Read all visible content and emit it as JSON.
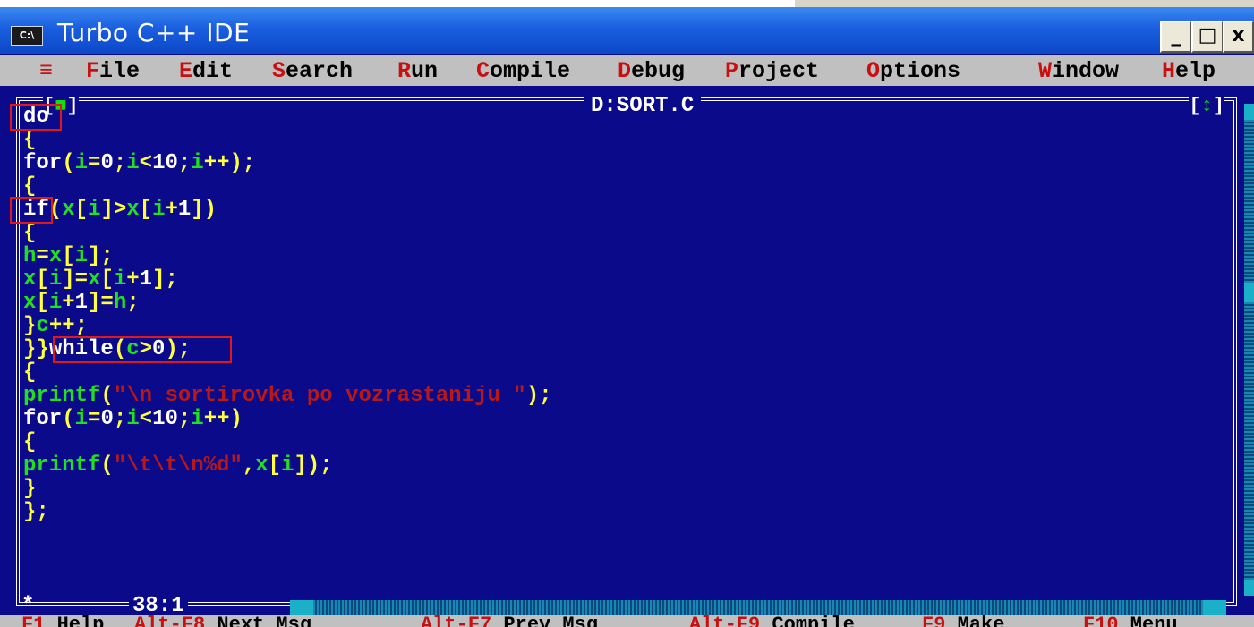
{
  "window": {
    "title": "Turbo C++ IDE",
    "sys_icon_label": "C:\\",
    "minimize_label": "_",
    "maximize_label": "□",
    "close_label": "x"
  },
  "menu": [
    {
      "hk": "≡",
      "rest": ""
    },
    {
      "hk": "F",
      "rest": "ile"
    },
    {
      "hk": "E",
      "rest": "dit"
    },
    {
      "hk": "S",
      "rest": "earch"
    },
    {
      "hk": "R",
      "rest": "un"
    },
    {
      "hk": "C",
      "rest": "ompile"
    },
    {
      "hk": "D",
      "rest": "ebug"
    },
    {
      "hk": "P",
      "rest": "roject"
    },
    {
      "hk": "O",
      "rest": "ptions"
    },
    {
      "hk": "W",
      "rest": "indow"
    },
    {
      "hk": "H",
      "rest": "elp"
    }
  ],
  "editor": {
    "filename": "D:SORT.C",
    "close_bracket_left": "[",
    "close_box": "■",
    "close_bracket_right": "]",
    "zoom_bracket_left": "[",
    "zoom_box": "↕",
    "zoom_bracket_right": "]",
    "cursor_position": "38:1",
    "modified_marker": "*"
  },
  "code_lines": [
    [
      {
        "t": "do",
        "c": "w"
      }
    ],
    [
      {
        "t": "{",
        "c": "y"
      }
    ],
    [
      {
        "t": "for",
        "c": "w"
      },
      {
        "t": "(",
        "c": "y"
      },
      {
        "t": "i",
        "c": "g"
      },
      {
        "t": "=",
        "c": "y"
      },
      {
        "t": "0",
        "c": "w"
      },
      {
        "t": ";",
        "c": "y"
      },
      {
        "t": "i",
        "c": "g"
      },
      {
        "t": "<",
        "c": "y"
      },
      {
        "t": "10",
        "c": "w"
      },
      {
        "t": ";",
        "c": "y"
      },
      {
        "t": "i",
        "c": "g"
      },
      {
        "t": "++);",
        "c": "y"
      }
    ],
    [
      {
        "t": "{",
        "c": "y"
      }
    ],
    [
      {
        "t": "if",
        "c": "w"
      },
      {
        "t": "(",
        "c": "y"
      },
      {
        "t": "x",
        "c": "g"
      },
      {
        "t": "[",
        "c": "y"
      },
      {
        "t": "i",
        "c": "g"
      },
      {
        "t": "]>",
        "c": "y"
      },
      {
        "t": "x",
        "c": "g"
      },
      {
        "t": "[",
        "c": "y"
      },
      {
        "t": "i",
        "c": "g"
      },
      {
        "t": "+",
        "c": "y"
      },
      {
        "t": "1",
        "c": "w"
      },
      {
        "t": "])",
        "c": "y"
      }
    ],
    [
      {
        "t": "{",
        "c": "y"
      }
    ],
    [
      {
        "t": "h",
        "c": "g"
      },
      {
        "t": "=",
        "c": "y"
      },
      {
        "t": "x",
        "c": "g"
      },
      {
        "t": "[",
        "c": "y"
      },
      {
        "t": "i",
        "c": "g"
      },
      {
        "t": "];",
        "c": "y"
      }
    ],
    [
      {
        "t": "x",
        "c": "g"
      },
      {
        "t": "[",
        "c": "y"
      },
      {
        "t": "i",
        "c": "g"
      },
      {
        "t": "]=",
        "c": "y"
      },
      {
        "t": "x",
        "c": "g"
      },
      {
        "t": "[",
        "c": "y"
      },
      {
        "t": "i",
        "c": "g"
      },
      {
        "t": "+",
        "c": "y"
      },
      {
        "t": "1",
        "c": "w"
      },
      {
        "t": "];",
        "c": "y"
      }
    ],
    [
      {
        "t": "x",
        "c": "g"
      },
      {
        "t": "[",
        "c": "y"
      },
      {
        "t": "i",
        "c": "g"
      },
      {
        "t": "+",
        "c": "y"
      },
      {
        "t": "1",
        "c": "w"
      },
      {
        "t": "]=",
        "c": "y"
      },
      {
        "t": "h",
        "c": "g"
      },
      {
        "t": ";",
        "c": "y"
      }
    ],
    [
      {
        "t": "}",
        "c": "y"
      },
      {
        "t": "c",
        "c": "g"
      },
      {
        "t": "++;",
        "c": "y"
      }
    ],
    [
      {
        "t": "}}",
        "c": "y"
      },
      {
        "t": "while",
        "c": "w"
      },
      {
        "t": "(",
        "c": "y"
      },
      {
        "t": "c",
        "c": "g"
      },
      {
        "t": ">",
        "c": "y"
      },
      {
        "t": "0",
        "c": "w"
      },
      {
        "t": ");",
        "c": "y"
      }
    ],
    [
      {
        "t": "{",
        "c": "y"
      }
    ],
    [
      {
        "t": "printf",
        "c": "g"
      },
      {
        "t": "(",
        "c": "y"
      },
      {
        "t": "\"\\n sortirovka po vozrastaniju \"",
        "c": "r"
      },
      {
        "t": ");",
        "c": "y"
      }
    ],
    [
      {
        "t": "for",
        "c": "w"
      },
      {
        "t": "(",
        "c": "y"
      },
      {
        "t": "i",
        "c": "g"
      },
      {
        "t": "=",
        "c": "y"
      },
      {
        "t": "0",
        "c": "w"
      },
      {
        "t": ";",
        "c": "y"
      },
      {
        "t": "i",
        "c": "g"
      },
      {
        "t": "<",
        "c": "y"
      },
      {
        "t": "10",
        "c": "w"
      },
      {
        "t": ";",
        "c": "y"
      },
      {
        "t": "i",
        "c": "g"
      },
      {
        "t": "++)",
        "c": "y"
      }
    ],
    [
      {
        "t": "{",
        "c": "y"
      }
    ],
    [
      {
        "t": "printf",
        "c": "g"
      },
      {
        "t": "(",
        "c": "y"
      },
      {
        "t": "\"\\t\\t\\n%d\"",
        "c": "r"
      },
      {
        "t": ",",
        "c": "y"
      },
      {
        "t": "x",
        "c": "g"
      },
      {
        "t": "[",
        "c": "y"
      },
      {
        "t": "i",
        "c": "g"
      },
      {
        "t": "]);",
        "c": "y"
      }
    ],
    [
      {
        "t": "}",
        "c": "y"
      }
    ],
    [
      {
        "t": "};",
        "c": "y"
      }
    ]
  ],
  "fkeys": [
    {
      "k": "F1",
      "label": " Help"
    },
    {
      "k": "Alt-F8",
      "label": " Next Msg"
    },
    {
      "k": "Alt-F7",
      "label": " Prev Msg"
    },
    {
      "k": "Alt-F9",
      "label": " Compile"
    },
    {
      "k": "F9",
      "label": " Make"
    },
    {
      "k": "F10",
      "label": " Menu"
    }
  ]
}
